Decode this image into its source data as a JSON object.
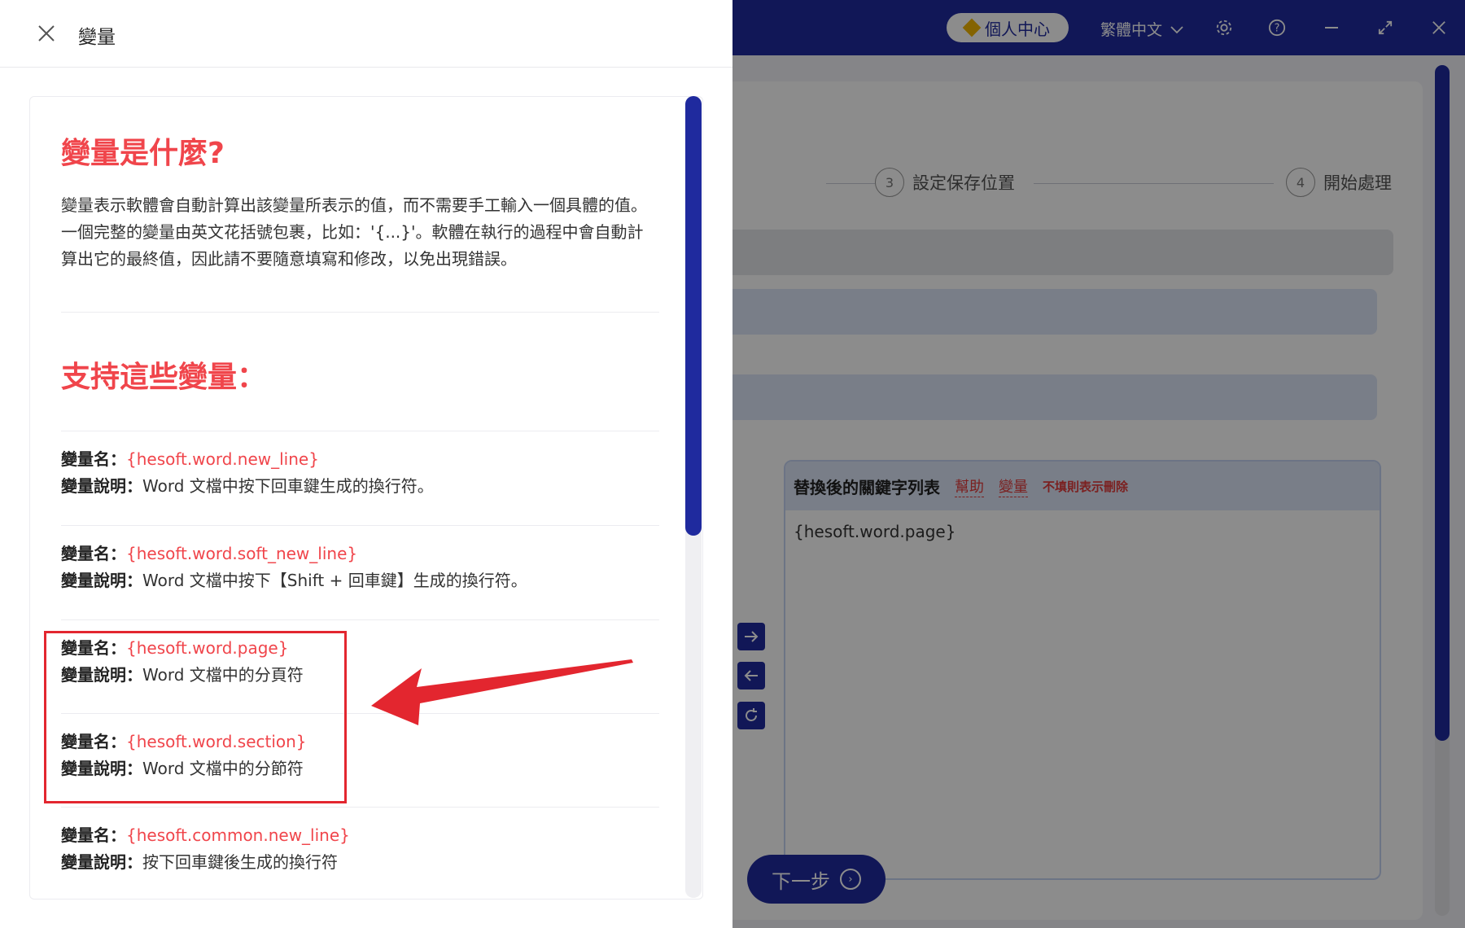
{
  "drawer": {
    "title": "變量",
    "section1_heading": "變量是什麼?",
    "intro": "變量表示軟體會自動計算出該變量所表示的值，而不需要手工輸入一個具體的值。一個完整的變量由英文花括號包裹，比如：'{...}'。軟體在執行的過程中會自動計算出它的最終值，因此請不要隨意填寫和修改，以免出現錯誤。",
    "section2_heading": "支持這些變量：",
    "name_label": "變量名：",
    "desc_label": "變量說明：",
    "variables": [
      {
        "name": "{hesoft.word.new_line}",
        "desc": "Word 文檔中按下回車鍵生成的換行符。"
      },
      {
        "name": "{hesoft.word.soft_new_line}",
        "desc": "Word 文檔中按下【Shift + 回車鍵】生成的換行符。"
      },
      {
        "name": "{hesoft.word.page}",
        "desc": "Word 文檔中的分頁符"
      },
      {
        "name": "{hesoft.word.section}",
        "desc": "Word 文檔中的分節符"
      },
      {
        "name": "{hesoft.common.new_line}",
        "desc": "按下回車鍵後生成的換行符"
      }
    ]
  },
  "app": {
    "personal_center": "個人中心",
    "language": "繁體中文",
    "steps": [
      {
        "num": "3",
        "label": "設定保存位置"
      },
      {
        "num": "4",
        "label": "開始處理"
      }
    ],
    "keyword_panel": {
      "title": "替換後的關鍵字列表",
      "help_link": "幫助",
      "variable_link": "變量",
      "note": "不填則表示刪除",
      "value": "{hesoft.word.page}"
    },
    "next_button": "下一步"
  },
  "colors": {
    "brand": "#1f2a9e",
    "accent_red": "#f0454b",
    "highlight": "#e3262f"
  }
}
